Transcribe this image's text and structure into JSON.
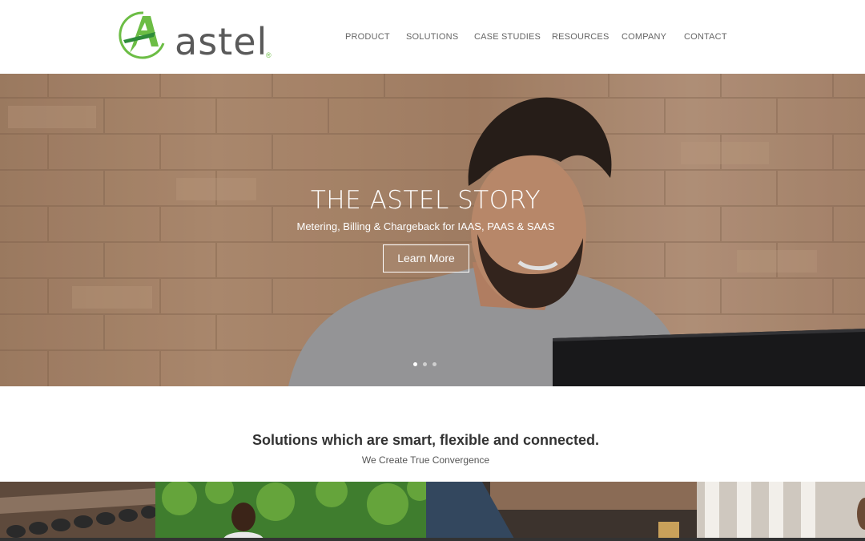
{
  "brand": {
    "name": "astel",
    "registered": "®",
    "accent": "#6cbd45"
  },
  "nav": {
    "items": [
      "PRODUCT",
      "SOLUTIONS",
      "CASE STUDIES",
      "RESOURCES",
      "COMPANY",
      "CONTACT"
    ]
  },
  "hero": {
    "title": "THE ASTEL STORY",
    "subtitle": "Metering, Billing & Chargeback for IAAS, PAAS & SAAS",
    "button_label": "Learn More",
    "slides": 3,
    "active_slide": 1
  },
  "tagline": {
    "title": "Solutions which are smart, flexible and connected.",
    "subtitle": "We Create True Convergence"
  }
}
